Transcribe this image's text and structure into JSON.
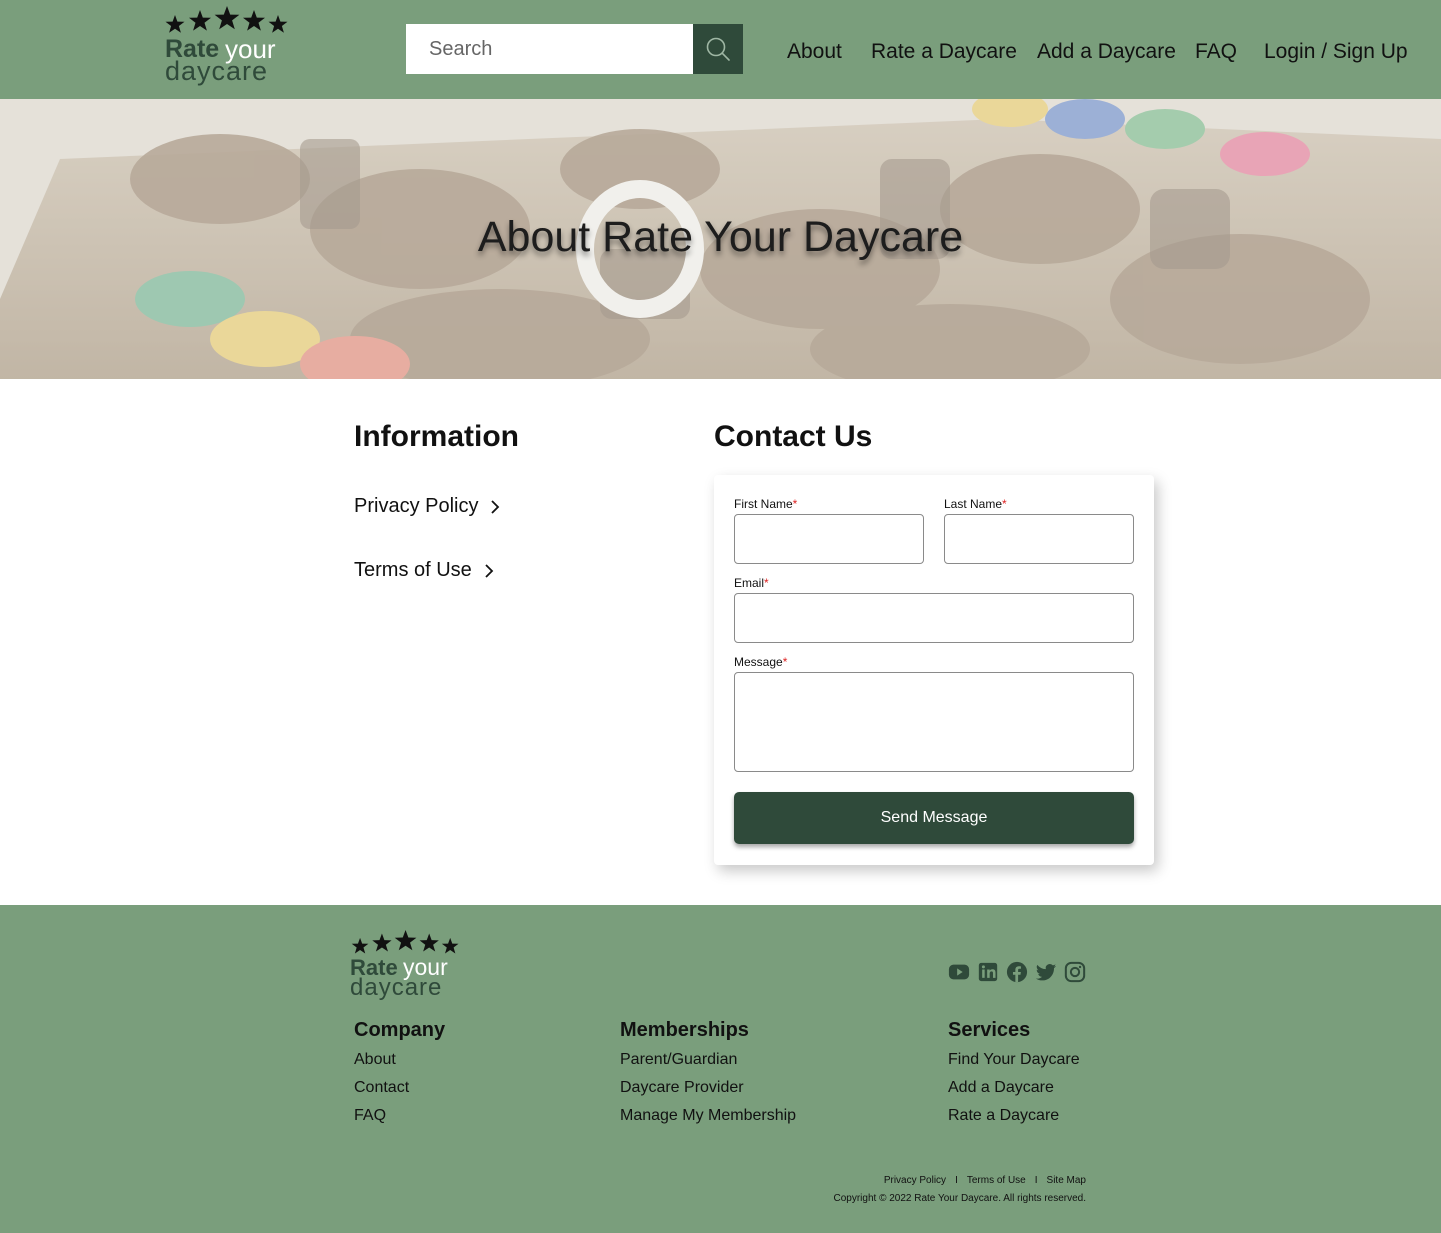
{
  "brand": {
    "logo_rate": "Rate",
    "logo_your": "your",
    "logo_daycare": "daycare"
  },
  "header": {
    "search_placeholder": "Search",
    "nav": [
      {
        "label": "About"
      },
      {
        "label": "Rate a Daycare"
      },
      {
        "label": "Add a Daycare"
      },
      {
        "label": "FAQ"
      },
      {
        "label": "Login / Sign Up"
      }
    ]
  },
  "hero": {
    "title": "About Rate Your Daycare"
  },
  "information": {
    "heading": "Information",
    "links": [
      {
        "label": "Privacy Policy"
      },
      {
        "label": "Terms of Use"
      }
    ]
  },
  "contact": {
    "heading": "Contact Us",
    "first_name_label": "First Name",
    "last_name_label": "Last Name",
    "email_label": "Email",
    "message_label": "Message",
    "required_marker": "*",
    "first_name_value": "",
    "last_name_value": "",
    "email_value": "",
    "message_value": "",
    "submit_label": "Send Message"
  },
  "footer": {
    "social": [
      "youtube-icon",
      "linkedin-icon",
      "facebook-icon",
      "twitter-icon",
      "instagram-icon"
    ],
    "columns": [
      {
        "heading": "Company",
        "links": [
          "About",
          "Contact",
          "FAQ"
        ]
      },
      {
        "heading": "Memberships",
        "links": [
          "Parent/Guardian",
          "Daycare Provider",
          "Manage My Membership"
        ]
      },
      {
        "heading": "Services",
        "links": [
          "Find Your Daycare",
          "Add a Daycare",
          "Rate a Daycare"
        ]
      }
    ],
    "legal_links": [
      "Privacy Policy",
      "Terms of Use",
      "Site Map"
    ],
    "legal_separator": "I",
    "copyright": "Copyright © 2022 Rate Your Daycare. All rights reserved."
  },
  "colors": {
    "brand_green": "#7a9e7c",
    "dark_green": "#2f4a3a",
    "required_red": "#dd2222"
  }
}
